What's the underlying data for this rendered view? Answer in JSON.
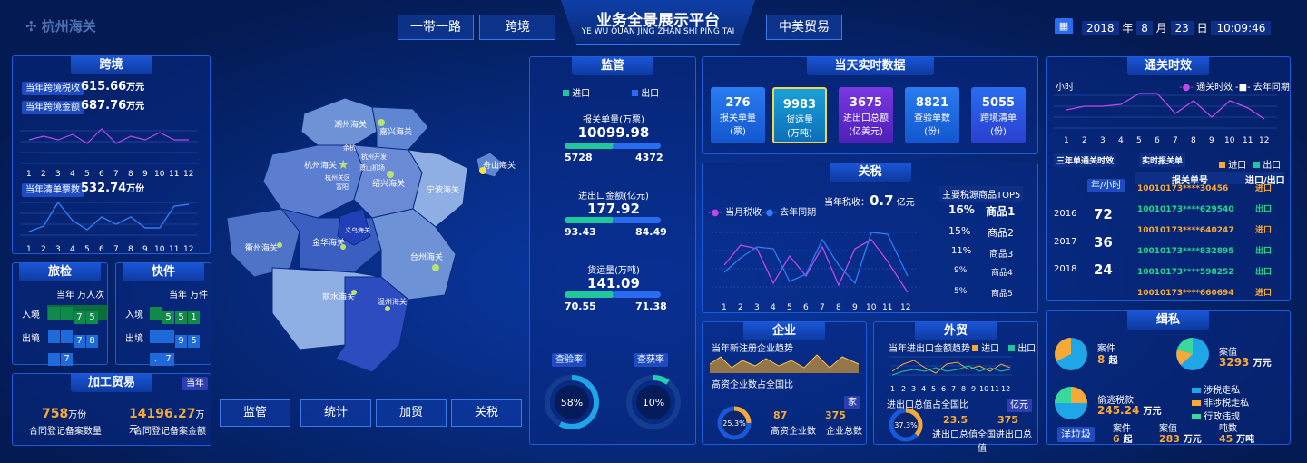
{
  "header": {
    "logo_text": "杭州海关",
    "title": "业务全景展示平台",
    "subtitle": "YE WU QUAN JING ZHAN SHI PING TAI",
    "nav": [
      "一带一路",
      "跨境",
      "中美贸易"
    ],
    "date": {
      "year": "2018",
      "year_unit": "年",
      "month": "8",
      "month_unit": "月",
      "day": "23",
      "day_unit": "日",
      "time": "10:09:46"
    }
  },
  "kuajing": {
    "title": "跨境",
    "tax_label": "当年跨境税收",
    "tax_value": "615.66",
    "tax_unit": "万元",
    "amount_label": "当年跨境金额",
    "amount_value": "687.76",
    "amount_unit": "万元",
    "months": [
      "1",
      "2",
      "3",
      "4",
      "5",
      "6",
      "7",
      "8",
      "9",
      "10",
      "11",
      "12"
    ],
    "orders_label": "当年清单票数",
    "orders_value": "532.74",
    "orders_unit": "万份"
  },
  "lvjian": {
    "title": "旅检",
    "head": "当年  万人次",
    "in_label": "入境",
    "in_digits": [
      "7",
      "5",
      ".",
      "6"
    ],
    "out_label": "出境",
    "out_digits": [
      "7",
      "8",
      ".",
      "7"
    ]
  },
  "kuaijian": {
    "title": "快件",
    "head": "当年  万件",
    "in_label": "入境",
    "in_digits": [
      "5",
      "5",
      "1",
      ".",
      "7"
    ],
    "out_label": "出境",
    "out_digits": [
      "9",
      "5",
      ".",
      "7"
    ]
  },
  "jiagong": {
    "title": "加工贸易",
    "badge": "当年",
    "count_value": "758",
    "count_unit": "万份",
    "count_label": "合同登记备案数量",
    "amount_value": "14196.27",
    "amount_unit": "万元",
    "amount_label": "合同登记备案金额"
  },
  "map": {
    "labels": [
      "湖州海关",
      "嘉兴海关",
      "杭州海关",
      "余杭",
      "杭州开发",
      "萧山机场",
      "杭州关区",
      "富阳",
      "绍兴海关",
      "宁波海关",
      "舟山海关",
      "衢州海关",
      "金华海关",
      "义乌海关",
      "台州海关",
      "丽水海关",
      "温州海关"
    ],
    "buttons": [
      "监管",
      "统计",
      "加贸",
      "关税"
    ]
  },
  "jianguan": {
    "title": "监管",
    "legend_in": "进口",
    "legend_out": "出口",
    "items": [
      {
        "label": "报关单量(万票)",
        "value": "10099.98",
        "in": "5728",
        "out": "4372"
      },
      {
        "label": "进出口金额(亿元)",
        "value": "177.92",
        "in": "93.43",
        "out": "84.49"
      },
      {
        "label": "货运量(万吨)",
        "value": "141.09",
        "in": "70.55",
        "out": "71.38"
      }
    ],
    "rate1_label": "查验率",
    "rate1": "58%",
    "rate2_label": "查获率",
    "rate2": "10%"
  },
  "realtime": {
    "title": "当天实时数据",
    "cards": [
      {
        "value": "276",
        "label": "报关单量\n(票)"
      },
      {
        "value": "9983",
        "label": "货运量\n(万吨)"
      },
      {
        "value": "3675",
        "label": "进出口总额\n(亿美元)"
      },
      {
        "value": "8821",
        "label": "查验单数\n(份)"
      },
      {
        "value": "5055",
        "label": "跨境清单\n(份)"
      }
    ]
  },
  "guanshui": {
    "title": "关税",
    "legend_cur": "当月税收",
    "legend_last": "去年同期",
    "year_tax_label": "当年税收：",
    "year_tax_value": "0.7",
    "year_tax_unit": "亿元",
    "top_title": "主要税源商品TOP5",
    "top": [
      {
        "pct": "16%",
        "name": "商品1"
      },
      {
        "pct": "15%",
        "name": "商品2"
      },
      {
        "pct": "11%",
        "name": "商品3"
      },
      {
        "pct": "9%",
        "name": "商品4"
      },
      {
        "pct": "5%",
        "name": "商品5"
      }
    ],
    "months": [
      "1",
      "2",
      "3",
      "4",
      "5",
      "6",
      "7",
      "8",
      "9",
      "10",
      "11",
      "12"
    ]
  },
  "qiye": {
    "title": "企业",
    "trend_label": "当年新注册企业趋势",
    "ratio_label": "高资企业数占全国比",
    "badge": "家",
    "pct": "25.3%",
    "v1": "87",
    "v1_label": "高资企业数",
    "v2": "375",
    "v2_label": "企业总数"
  },
  "waimao": {
    "title": "外贸",
    "trend_label": "当年进出口金额趋势",
    "legend_in": "进口",
    "legend_out": "出口",
    "months": [
      "1",
      "2",
      "3",
      "4",
      "5",
      "6",
      "7",
      "8",
      "9",
      "10",
      "11",
      "12"
    ],
    "ratio_label": "进出口总值占全国比",
    "badge": "亿元",
    "pct": "37.3%",
    "v1": "23.5",
    "v1_label": "进出口总值",
    "v2": "375",
    "v2_label": "全国进出口总值"
  },
  "tongguan": {
    "title": "通关时效",
    "y_label": "小时",
    "legend_cur": "通关时效",
    "legend_last": "去年同期",
    "months": [
      "1",
      "2",
      "3",
      "4",
      "5",
      "6",
      "7",
      "8",
      "9",
      "10",
      "11",
      "12"
    ],
    "left_title": "三年单通关时效",
    "unit_badge": "年/小时",
    "years": [
      {
        "year": "2016",
        "value": "72"
      },
      {
        "year": "2017",
        "value": "36"
      },
      {
        "year": "2018",
        "value": "24"
      }
    ],
    "right_title": "实时报关单",
    "legend_in": "进口",
    "legend_out": "出口",
    "col_no": "报关单号",
    "col_io": "进口/出口",
    "rows": [
      {
        "no": "10010173****30456",
        "io": "进口"
      },
      {
        "no": "10010173****629540",
        "io": "出口"
      },
      {
        "no": "10010173****640247",
        "io": "进口"
      },
      {
        "no": "10010173****832895",
        "io": "出口"
      },
      {
        "no": "10010173****598252",
        "io": "出口"
      },
      {
        "no": "10010173****660694",
        "io": "进口"
      }
    ]
  },
  "jisi": {
    "title": "缉私",
    "case_label": "案件",
    "case_value": "8",
    "case_unit": "起",
    "amount_label": "案值",
    "amount_value": "3293",
    "amount_unit": "万元",
    "evade_label": "偷逃税款",
    "evade_value": "245.24",
    "evade_unit": "万元",
    "legend": [
      "涉税走私",
      "非涉税走私",
      "行政违规"
    ],
    "garbage": "洋垃圾",
    "g_case_label": "案件",
    "g_case_value": "6",
    "g_case_unit": "起",
    "g_amount_label": "案值",
    "g_amount_value": "283",
    "g_amount_unit": "万元",
    "g_ton_label": "吨数",
    "g_ton_value": "45",
    "g_ton_unit": "万吨"
  },
  "colors": {
    "accent": "#1e5bd8",
    "green": "#1fc79a",
    "blue": "#2a6cf0",
    "orange": "#f7a935",
    "purple": "#c048e8"
  }
}
